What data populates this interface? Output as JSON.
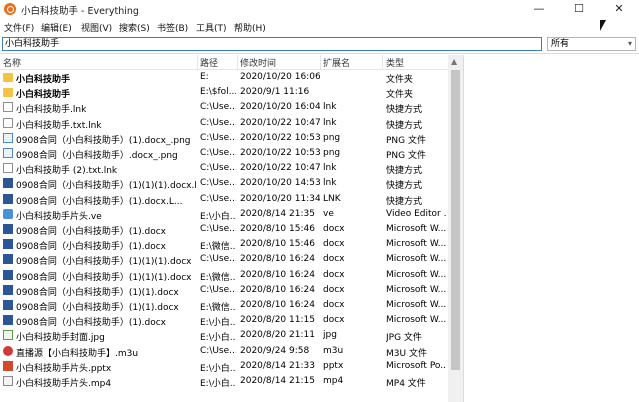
{
  "window": {
    "title": "小白科技助手 - Everything",
    "minimize": "—",
    "maximize": "☐",
    "close": "✕"
  },
  "menu": [
    "文件(F)",
    "编辑(E)",
    "视图(V)",
    "搜索(S)",
    "书签(B)",
    "工具(T)",
    "帮助(H)"
  ],
  "search": {
    "value": "小白科技助手",
    "filter": "所有"
  },
  "columns": {
    "name": "名称",
    "path": "路径",
    "date": "修改时间",
    "ext": "扩展名",
    "type": "类型"
  },
  "rows": [
    {
      "icon": "folder",
      "name": "小白科技助手",
      "bold": true,
      "path": "E:",
      "date": "2020/10/20 16:06",
      "ext": "",
      "type": "文件夹"
    },
    {
      "icon": "folder",
      "name": "小白科技助手",
      "bold": true,
      "path": "E:\\$fol...",
      "date": "2020/9/1 11:16",
      "ext": "",
      "type": "文件夹"
    },
    {
      "icon": "lnk",
      "name": "小白科技助手.lnk",
      "path": "C:\\Use...",
      "date": "2020/10/20 16:04",
      "ext": "lnk",
      "type": "快捷方式"
    },
    {
      "icon": "lnk",
      "name": "小白科技助手.txt.lnk",
      "path": "C:\\Use...",
      "date": "2020/10/22 10:47",
      "ext": "lnk",
      "type": "快捷方式"
    },
    {
      "icon": "png",
      "name": "0908合同（小白科技助手）(1).docx_.png",
      "path": "C:\\Use...",
      "date": "2020/10/22 10:53",
      "ext": "png",
      "type": "PNG 文件"
    },
    {
      "icon": "png",
      "name": "0908合同（小白科技助手）.docx_.png",
      "path": "C:\\Use...",
      "date": "2020/10/22 10:53",
      "ext": "png",
      "type": "PNG 文件"
    },
    {
      "icon": "lnk",
      "name": "小白科技助手 (2).txt.lnk",
      "path": "C:\\Use...",
      "date": "2020/10/22 10:47",
      "ext": "lnk",
      "type": "快捷方式"
    },
    {
      "icon": "docx",
      "name": "0908合同（小白科技助手）(1)(1)(1).docx.lnk",
      "path": "C:\\Use...",
      "date": "2020/10/20 14:53",
      "ext": "lnk",
      "type": "快捷方式"
    },
    {
      "icon": "docx",
      "name": "0908合同（小白科技助手）(1).docx.L...",
      "path": "C:\\Use...",
      "date": "2020/10/20 11:34",
      "ext": "LNK",
      "type": "快捷方式"
    },
    {
      "icon": "ve",
      "name": "小白科技助手片头.ve",
      "path": "E:\\小白...",
      "date": "2020/8/14 21:35",
      "ext": "ve",
      "type": "Video Editor ..."
    },
    {
      "icon": "docx",
      "name": "0908合同（小白科技助手）(1).docx",
      "path": "C:\\Use...",
      "date": "2020/8/10 15:46",
      "ext": "docx",
      "type": "Microsoft W..."
    },
    {
      "icon": "docx",
      "name": "0908合同（小白科技助手）(1).docx",
      "path": "E:\\微信...",
      "date": "2020/8/10 15:46",
      "ext": "docx",
      "type": "Microsoft W..."
    },
    {
      "icon": "docx",
      "name": "0908合同（小白科技助手）(1)(1)(1).docx",
      "path": "C:\\Use...",
      "date": "2020/8/10 16:24",
      "ext": "docx",
      "type": "Microsoft W..."
    },
    {
      "icon": "docx",
      "name": "0908合同（小白科技助手）(1)(1)(1).docx",
      "path": "E:\\微信...",
      "date": "2020/8/10 16:24",
      "ext": "docx",
      "type": "Microsoft W..."
    },
    {
      "icon": "docx",
      "name": "0908合同（小白科技助手）(1)(1).docx",
      "path": "C:\\Use...",
      "date": "2020/8/10 16:24",
      "ext": "docx",
      "type": "Microsoft W..."
    },
    {
      "icon": "docx",
      "name": "0908合同（小白科技助手）(1)(1).docx",
      "path": "E:\\微信...",
      "date": "2020/8/10 16:24",
      "ext": "docx",
      "type": "Microsoft W..."
    },
    {
      "icon": "docx",
      "name": "0908合同（小白科技助手）(1).docx",
      "path": "E:\\小白...",
      "date": "2020/8/20 11:15",
      "ext": "docx",
      "type": "Microsoft W..."
    },
    {
      "icon": "jpg",
      "name": "小白科技助手封面.jpg",
      "path": "E:\\小白...",
      "date": "2020/8/20 21:11",
      "ext": "jpg",
      "type": "JPG 文件"
    },
    {
      "icon": "m3u",
      "name": "直播源【小白科技助手】.m3u",
      "path": "C:\\Use...",
      "date": "2020/9/24 9:58",
      "ext": "m3u",
      "type": "M3U 文件"
    },
    {
      "icon": "pptx",
      "name": "小白科技助手片头.pptx",
      "path": "E:\\小白...",
      "date": "2020/8/14 21:33",
      "ext": "pptx",
      "type": "Microsoft Po..."
    },
    {
      "icon": "mp4",
      "name": "小白科技助手片头.mp4",
      "path": "E:\\小白...",
      "date": "2020/8/14 21:15",
      "ext": "mp4",
      "type": "MP4 文件"
    }
  ]
}
